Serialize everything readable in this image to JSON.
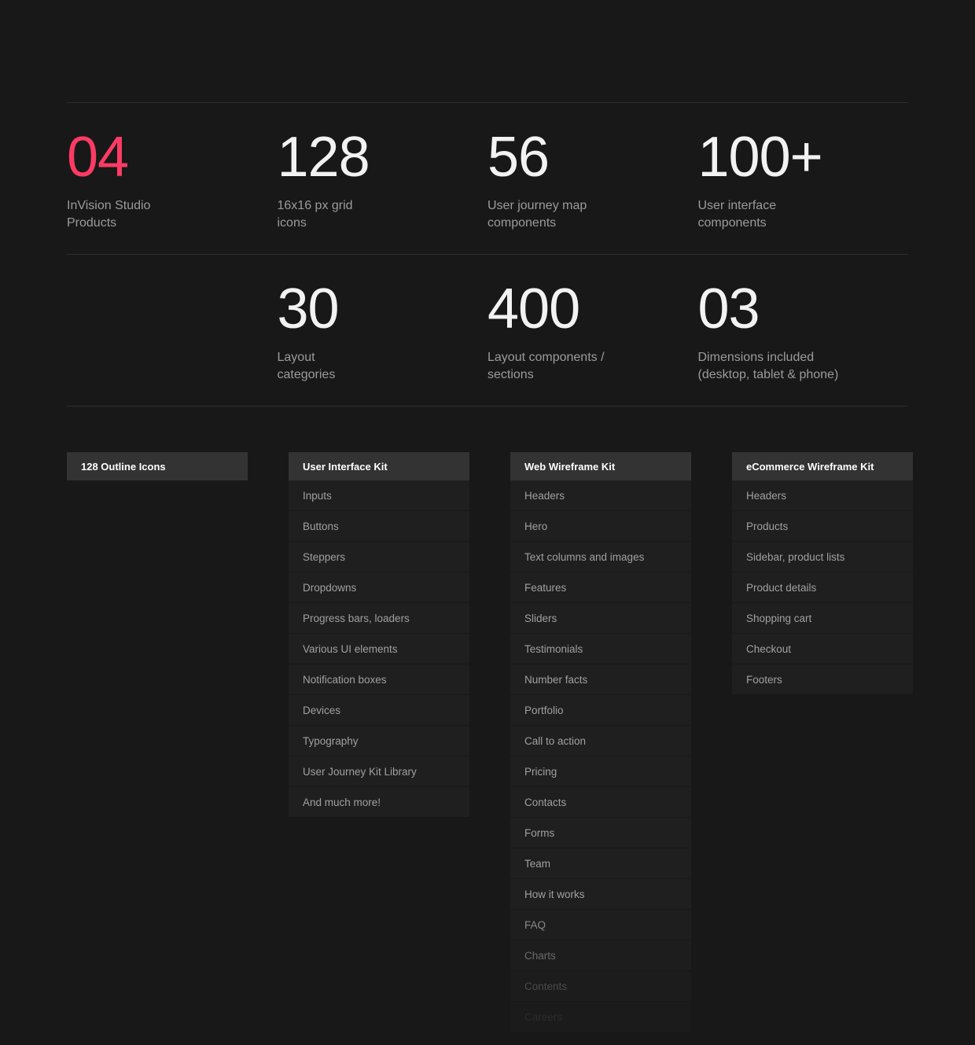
{
  "stats": {
    "rows": [
      [
        {
          "number": "04",
          "label": "InVision Studio\nProducts",
          "accent": true
        },
        {
          "number": "128",
          "label": "16x16 px grid\nicons",
          "accent": false
        },
        {
          "number": "56",
          "label": "User journey map\ncomponents",
          "accent": false
        },
        {
          "number": "100+",
          "label": "User interface\ncomponents",
          "accent": false
        }
      ],
      [
        {
          "number": "",
          "label": "",
          "accent": false,
          "empty": true
        },
        {
          "number": "30",
          "label": "Layout\ncategories",
          "accent": false
        },
        {
          "number": "400",
          "label": "Layout components /\nsections",
          "accent": false
        },
        {
          "number": "03",
          "label": "Dimensions included\n(desktop, tablet & phone)",
          "accent": false
        }
      ]
    ]
  },
  "kits": [
    {
      "title": "128 Outline Icons",
      "items": []
    },
    {
      "title": "User Interface Kit",
      "items": [
        "Inputs",
        "Buttons",
        "Steppers",
        "Dropdowns",
        "Progress bars, loaders",
        "Various UI elements",
        "Notification boxes",
        "Devices",
        "Typography",
        "User Journey Kit Library",
        "And much more!"
      ]
    },
    {
      "title": "Web Wireframe Kit",
      "items": [
        "Headers",
        "Hero",
        "Text columns and images",
        "Features",
        "Sliders",
        "Testimonials",
        "Number facts",
        "Portfolio",
        "Call to action",
        "Pricing",
        "Contacts",
        "Forms",
        "Team",
        "How it works",
        "FAQ",
        "Charts",
        "Contents",
        "Careers"
      ]
    },
    {
      "title": "eCommerce Wireframe Kit",
      "items": [
        "Headers",
        "Products",
        "Sidebar, product lists",
        "Product details",
        "Shopping cart",
        "Checkout",
        "Footers"
      ]
    }
  ],
  "colors": {
    "background": "#181818",
    "accent": "#fb3b64",
    "divider": "#2e2e2e",
    "row": "#1f1f1f",
    "header_row": "#333333",
    "label_text": "#9b9b9b",
    "number_text": "#f2f2f2"
  }
}
